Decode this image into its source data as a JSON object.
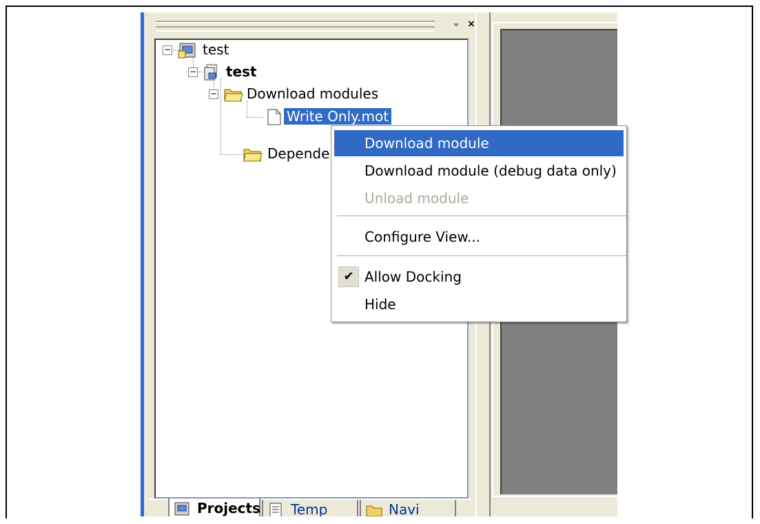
{
  "window": {
    "dropdown_icon": "chevron-down-icon",
    "close_glyph": "×",
    "accent_color": "#316ac5"
  },
  "tree": {
    "workspace_label": "test",
    "project_label": "test",
    "download_folder_label": "Download modules",
    "selected_file_label": "Write Only.mot",
    "dependencies_label": "Depende"
  },
  "context_menu": {
    "items": [
      {
        "label": "Download module",
        "state": "highlighted"
      },
      {
        "label": "Download module (debug data only)",
        "state": "normal"
      },
      {
        "label": "Unload module",
        "state": "disabled"
      },
      {
        "label": "Configure View...",
        "state": "normal"
      },
      {
        "label": "Allow Docking",
        "state": "checked"
      },
      {
        "label": "Hide",
        "state": "normal"
      }
    ]
  },
  "tabs": {
    "projects": "Projects",
    "templates": "Temp",
    "navigation": "Navi"
  }
}
